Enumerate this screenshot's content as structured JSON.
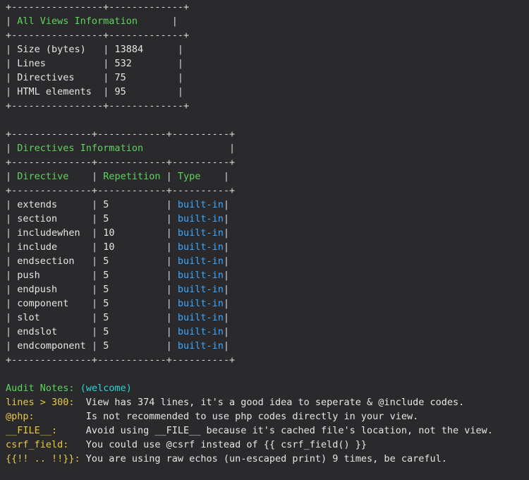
{
  "views_table": {
    "title": "All Views Information",
    "rows": [
      {
        "label": "Size (bytes)",
        "value": "13884"
      },
      {
        "label": "Lines",
        "value": "532"
      },
      {
        "label": "Directives",
        "value": "75"
      },
      {
        "label": "HTML elements",
        "value": "95"
      }
    ]
  },
  "directives_table": {
    "title": "Directives Information",
    "headers": [
      "Directive",
      "Repetition",
      "Type"
    ],
    "rows": [
      {
        "directive": "extends",
        "repetition": "5",
        "type": "built-in"
      },
      {
        "directive": "section",
        "repetition": "5",
        "type": "built-in"
      },
      {
        "directive": "includewhen",
        "repetition": "10",
        "type": "built-in"
      },
      {
        "directive": "include",
        "repetition": "10",
        "type": "built-in"
      },
      {
        "directive": "endsection",
        "repetition": "5",
        "type": "built-in"
      },
      {
        "directive": "push",
        "repetition": "5",
        "type": "built-in"
      },
      {
        "directive": "endpush",
        "repetition": "5",
        "type": "built-in"
      },
      {
        "directive": "component",
        "repetition": "5",
        "type": "built-in"
      },
      {
        "directive": "slot",
        "repetition": "5",
        "type": "built-in"
      },
      {
        "directive": "endslot",
        "repetition": "5",
        "type": "built-in"
      },
      {
        "directive": "endcomponent",
        "repetition": "5",
        "type": "built-in"
      }
    ]
  },
  "audit": {
    "title": "Audit Notes:",
    "view_name": "(welcome)",
    "notes": [
      {
        "key": "lines > 300:",
        "message": "View has 374 lines, it's a good idea to seperate & @include codes."
      },
      {
        "key": "@php:",
        "message": "Is not recommended to use php codes directly in your view."
      },
      {
        "key": "__FILE__:",
        "message": "Avoid using __FILE__ because it's cached file's location, not the view."
      },
      {
        "key": "csrf_field:",
        "message": "You could use @csrf instead of {{ csrf_field() }}"
      },
      {
        "key": "{{!! .. !!}}:",
        "message": "You are using raw echos (un-escaped print) 9 times, be careful."
      }
    ]
  }
}
